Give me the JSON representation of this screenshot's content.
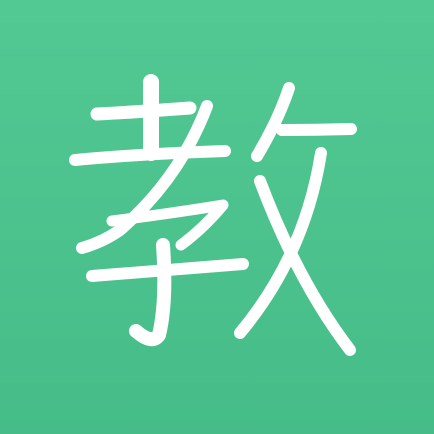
{
  "app_icon": {
    "glyph": "教",
    "background_color": "#4cc590",
    "glyph_color": "#ffffff"
  }
}
